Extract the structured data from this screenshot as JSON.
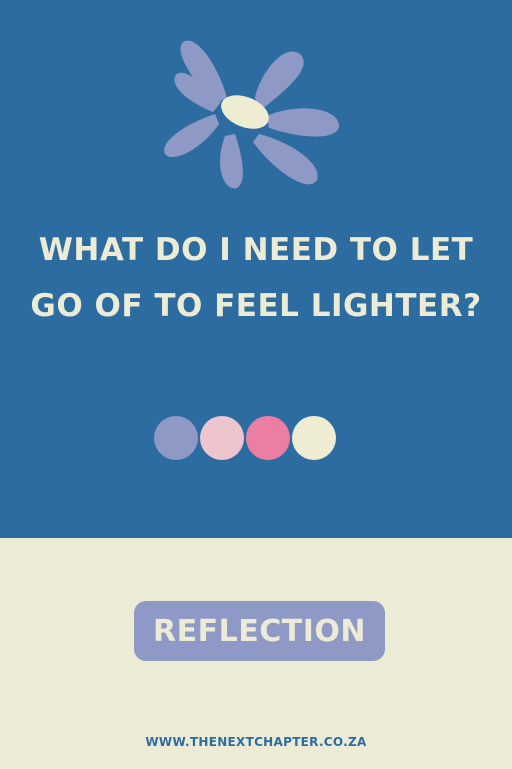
{
  "card": {
    "question": "WHAT DO I NEED TO LET GO OF TO FEEL LIGHTER?",
    "category_label": "REFLECTION",
    "website": "WWW.THENEXTCHAPTER.CO.ZA"
  },
  "colors": {
    "top_background": "#2d6ca0",
    "bottom_background": "#ecebd5",
    "petal": "#8e99c6",
    "flower_center": "#efecd4",
    "text_light": "#ecebd5",
    "badge": "#8e99c6",
    "url_text": "#2d6ca0"
  },
  "palette_dots": [
    {
      "name": "periwinkle",
      "color": "#8e99c6"
    },
    {
      "name": "light-pink",
      "color": "#eec4cf"
    },
    {
      "name": "pink",
      "color": "#ec7ea4"
    },
    {
      "name": "cream",
      "color": "#efecd4"
    }
  ],
  "icons": {
    "flower": "flower-icon"
  }
}
